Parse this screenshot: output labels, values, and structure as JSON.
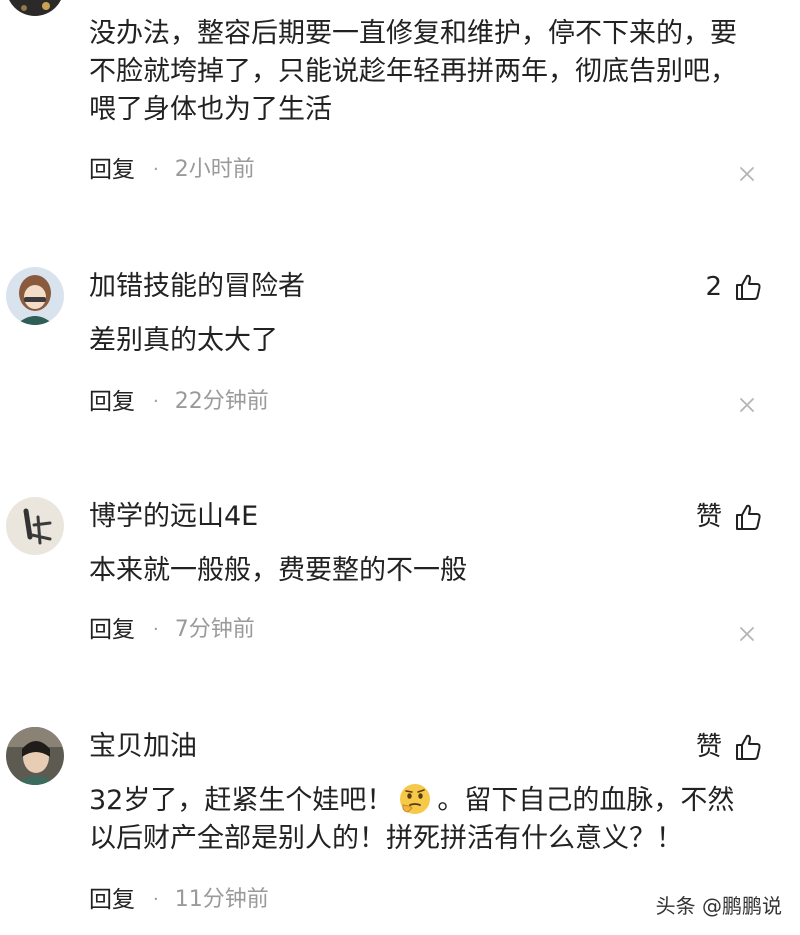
{
  "comments": [
    {
      "content_lines": [
        "没办法，整容后期要一直修复和维护，停不下来的，要",
        "不脸就垮掉了，只能说趁年轻再拼两年，彻底告别吧，",
        "喂了身体也为了生活"
      ],
      "reply_label": "回复",
      "time": "2小时前"
    },
    {
      "username": "加错技能的冒险者",
      "like_text": "2",
      "content": "差别真的太大了",
      "reply_label": "回复",
      "time": "22分钟前"
    },
    {
      "username": "博学的远山4E",
      "like_text": "赞",
      "content": "本来就一般般，费要整的不一般",
      "reply_label": "回复",
      "time": "7分钟前"
    },
    {
      "username": "宝贝加油",
      "like_text": "赞",
      "content_before_emoji": "32岁了，赶紧生个娃吧！",
      "emoji": "thinking-face-emoji",
      "content_after_emoji": "。留下自己的血脉，不然",
      "content_line2": "以后财产全部是别人的！拼死拼活有什么意义？！",
      "reply_label": "回复",
      "time": "11分钟前"
    }
  ],
  "watermark": "头条 @鹏鹏说",
  "colors": {
    "text": "#222222",
    "muted": "#9a9a9a",
    "background": "#ffffff"
  }
}
